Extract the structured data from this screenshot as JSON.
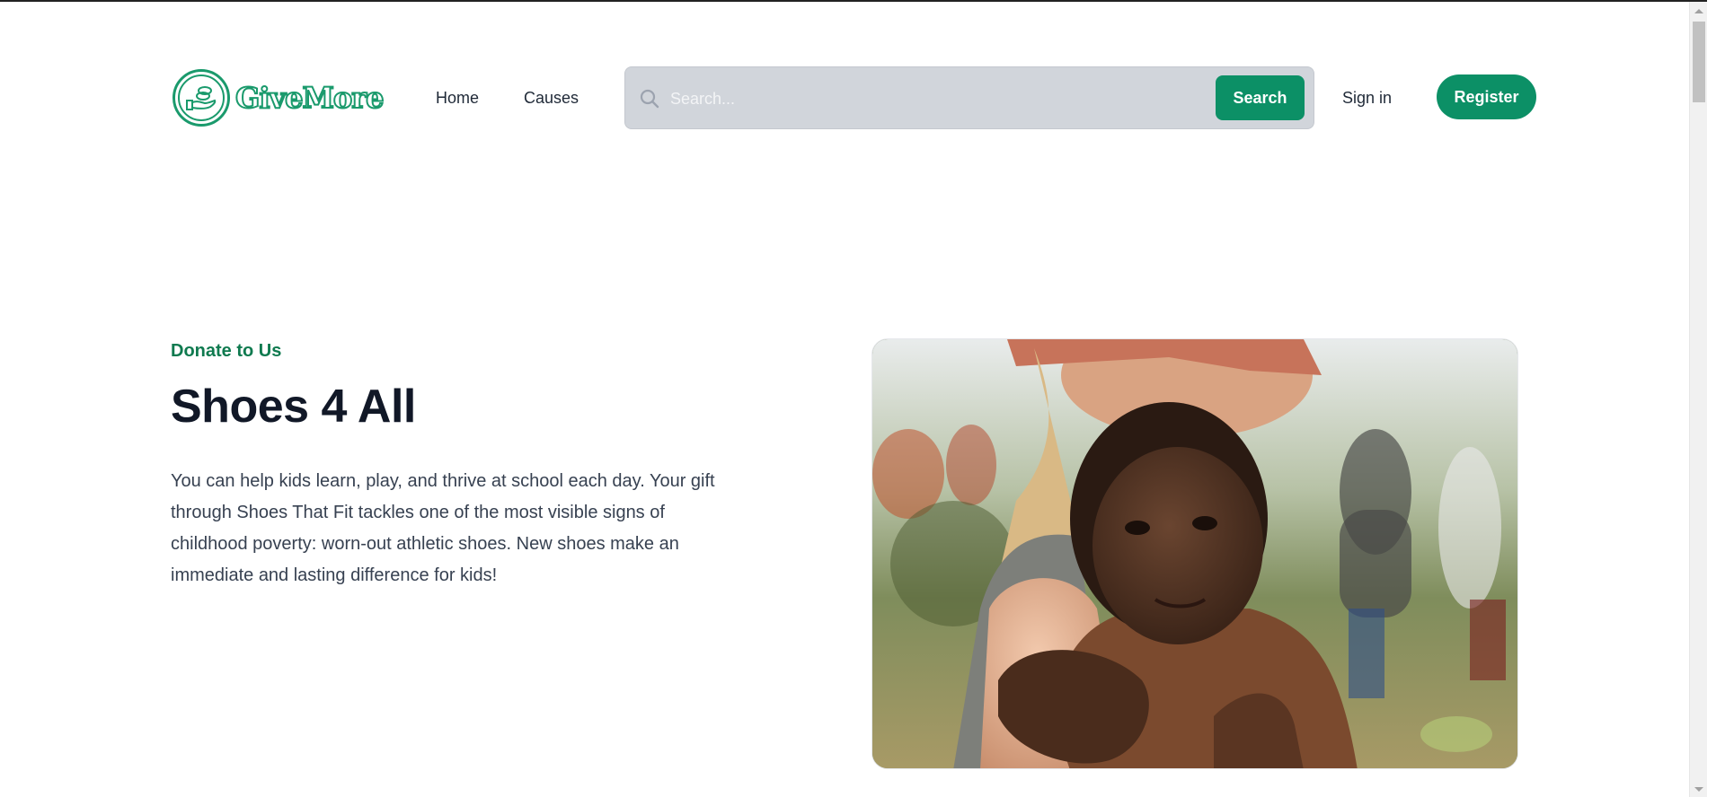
{
  "header": {
    "logo_text": "GiveMore",
    "nav": [
      {
        "label": "Home"
      },
      {
        "label": "Causes"
      }
    ],
    "search": {
      "placeholder": "Search...",
      "value": "",
      "button_label": "Search"
    },
    "signin_label": "Sign in",
    "register_label": "Register"
  },
  "hero": {
    "eyebrow": "Donate to Us",
    "title": "Shoes 4 All",
    "description": "You can help kids learn, play, and thrive at school each day. Your gift through Shoes That Fit tackles one of the most visible signs of childhood poverty: worn-out athletic shoes. New shoes make an immediate and lasting difference for kids!"
  },
  "colors": {
    "brand": "#0c9066",
    "eyebrow": "#0f7a4f",
    "search_bg": "#d1d5db"
  },
  "icons": {
    "logo": "hand-coins-icon",
    "search": "search-icon"
  }
}
